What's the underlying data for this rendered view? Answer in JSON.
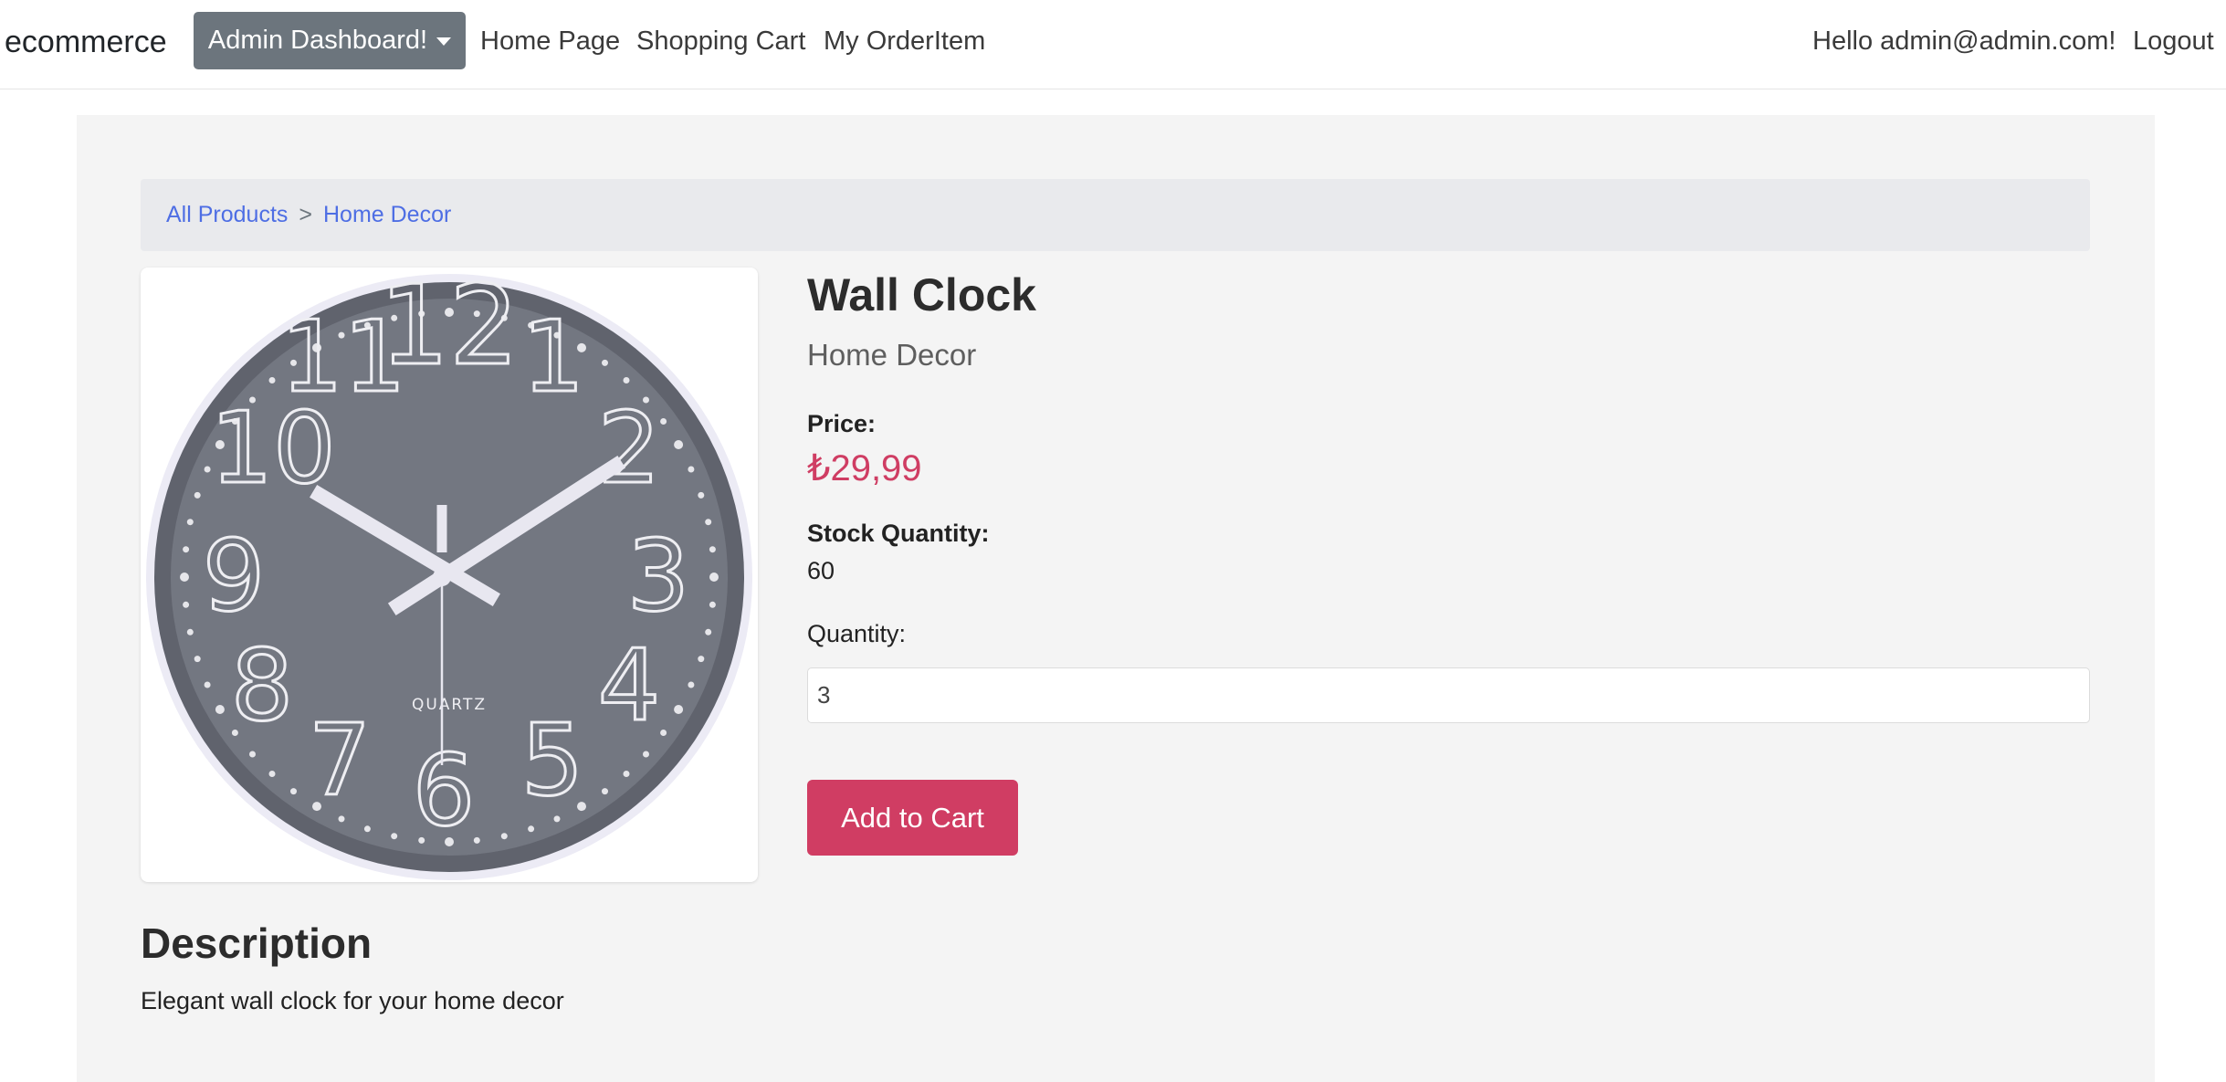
{
  "navbar": {
    "brand": "ecommerce",
    "dropdown_label": "Admin Dashboard!",
    "links": [
      "Home Page",
      "Shopping Cart",
      "My OrderItem"
    ],
    "greeting": "Hello admin@admin.com!",
    "logout": "Logout"
  },
  "breadcrumb": {
    "items": [
      "All Products",
      "Home Decor"
    ],
    "separator": ">"
  },
  "product": {
    "image_icon": "wall-clock-image",
    "image_brand_text": "QUARTZ",
    "name": "Wall Clock",
    "category": "Home Decor",
    "price_label": "Price:",
    "price": "₺29,99",
    "stock_label": "Stock Quantity:",
    "stock": "60",
    "quantity_label": "Quantity:",
    "quantity_value": "3",
    "add_to_cart": "Add to Cart",
    "description_title": "Description",
    "description": "Elegant wall clock for your home decor"
  },
  "colors": {
    "accent": "#d03d63",
    "link": "#4e6ee4",
    "dropdown_bg": "#6c757d",
    "container_bg": "#f4f4f4",
    "breadcrumb_bg": "#e9eaed"
  }
}
